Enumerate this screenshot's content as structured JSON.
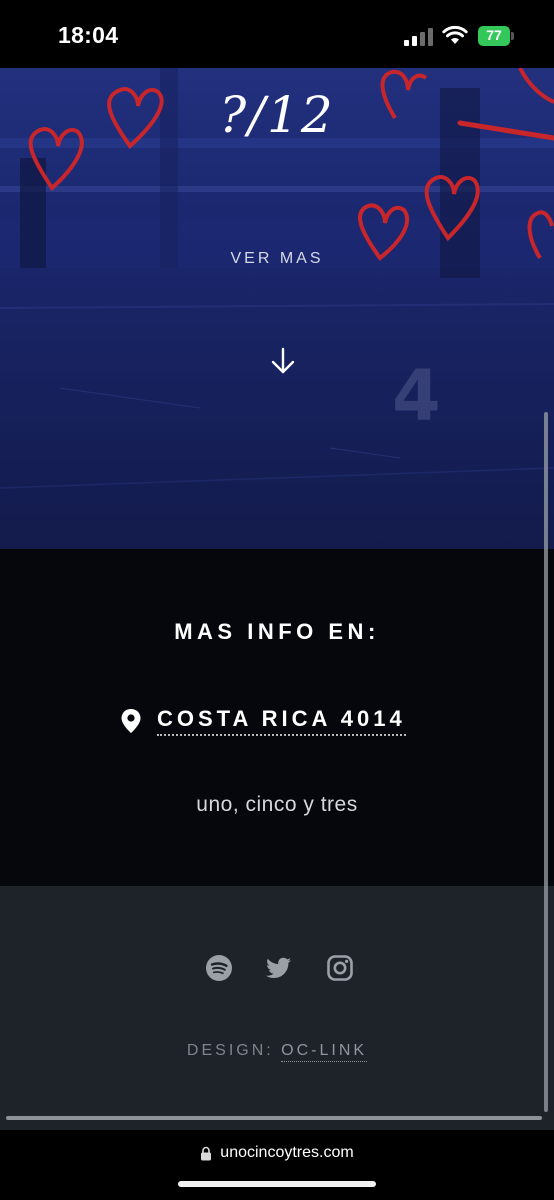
{
  "status_bar": {
    "time": "18:04",
    "battery": "77"
  },
  "hero": {
    "counter": "?/12",
    "ver_mas": "VER MAS"
  },
  "info": {
    "title": "MAS INFO EN:",
    "address": "COSTA RICA 4014",
    "tagline": "uno, cinco y tres"
  },
  "footer": {
    "social_icons": [
      "spotify-icon",
      "twitter-icon",
      "instagram-icon"
    ],
    "design_label": "DESIGN:",
    "design_link": "OC-LINK"
  },
  "browser": {
    "url": "unocincoytres.com"
  },
  "colors": {
    "hero_blue": "#1c2a78",
    "info_bg": "#05070c",
    "footer_bg": "#1e2329",
    "battery_green": "#34c759",
    "heart_red": "#c8262b"
  }
}
